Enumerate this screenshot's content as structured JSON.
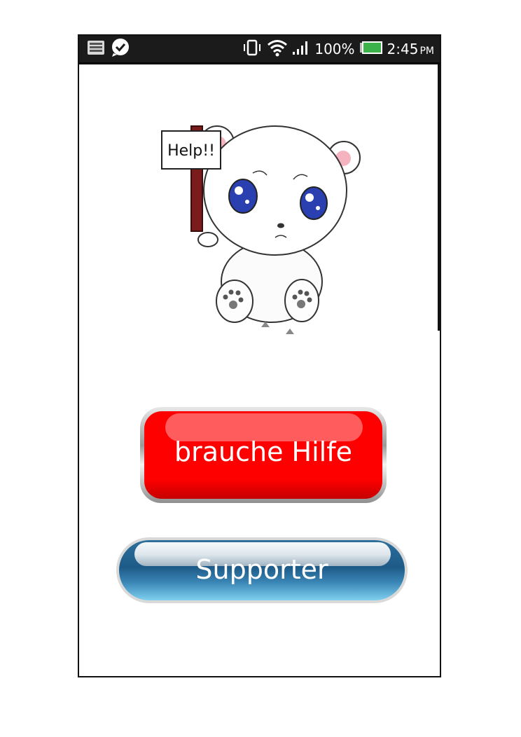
{
  "status_bar": {
    "left_icons": [
      "message-icon",
      "checkmark-bubble-icon"
    ],
    "right_icons": [
      "vibrate-icon",
      "wifi-icon",
      "signal-icon",
      "battery-icon"
    ],
    "battery": "100%",
    "time": "2:45",
    "ampm": "PM",
    "battery_color": "#3cb34a"
  },
  "illustration": {
    "sign_text": "Help!!"
  },
  "buttons": {
    "help_label": "brauche Hilfe",
    "support_label": "Supporter"
  },
  "colors": {
    "help_button": "#ff0000",
    "support_button": "#1d5a88"
  }
}
